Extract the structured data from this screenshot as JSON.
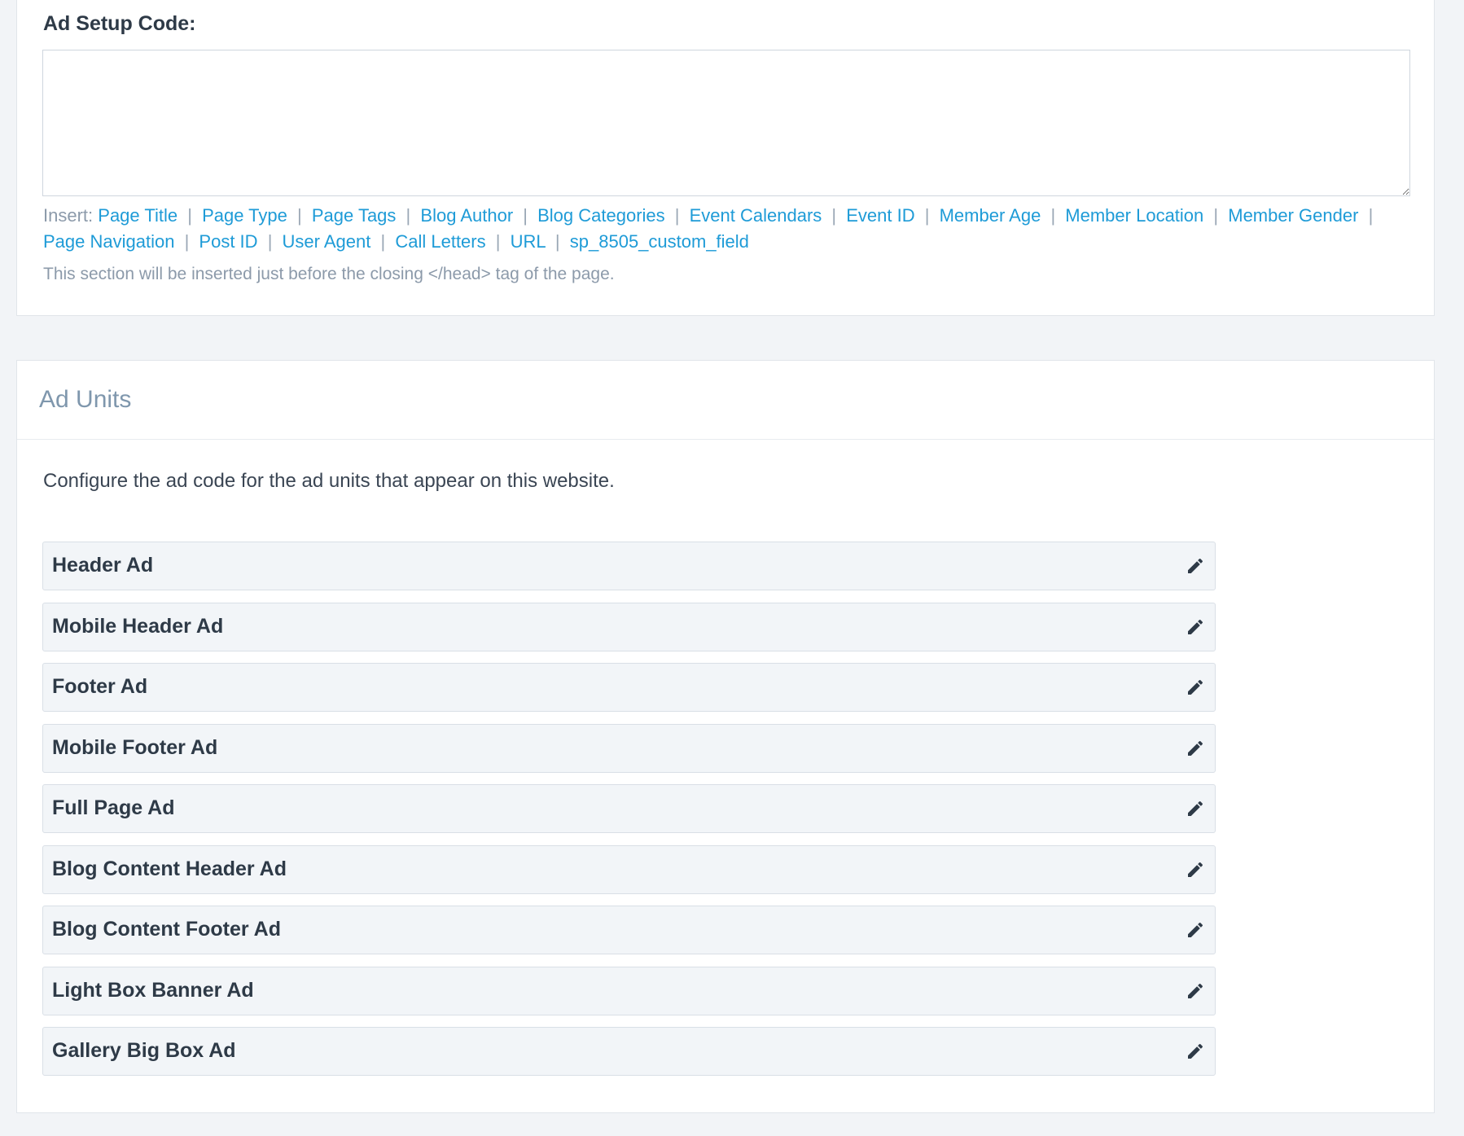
{
  "ad_setup": {
    "label": "Ad Setup Code:",
    "textarea_value": "",
    "insert_prefix": "Insert:",
    "insert_tokens": [
      "Page Title",
      "Page Type",
      "Page Tags",
      "Blog Author",
      "Blog Categories",
      "Event Calendars",
      "Event ID",
      "Member Age",
      "Member Location",
      "Member Gender",
      "Page Navigation",
      "Post ID",
      "User Agent",
      "Call Letters",
      "URL",
      "sp_8505_custom_field"
    ],
    "separator": "|",
    "help_text": "This section will be inserted just before the closing </head> tag of the page."
  },
  "ad_units": {
    "title": "Ad Units",
    "intro": "Configure the ad code for the ad units that appear on this website.",
    "edit_icon": "pencil-icon",
    "items": [
      "Header Ad",
      "Mobile Header Ad",
      "Footer Ad",
      "Mobile Footer Ad",
      "Full Page Ad",
      "Blog Content Header Ad",
      "Blog Content Footer Ad",
      "Light Box Banner Ad",
      "Gallery Big Box Ad"
    ]
  },
  "colors": {
    "link": "#1e9bd7",
    "background": "#f2f4f7",
    "panel": "#ffffff",
    "row_background": "#f2f5f8",
    "text": "#2e3a47",
    "muted": "#8c9aaa"
  }
}
